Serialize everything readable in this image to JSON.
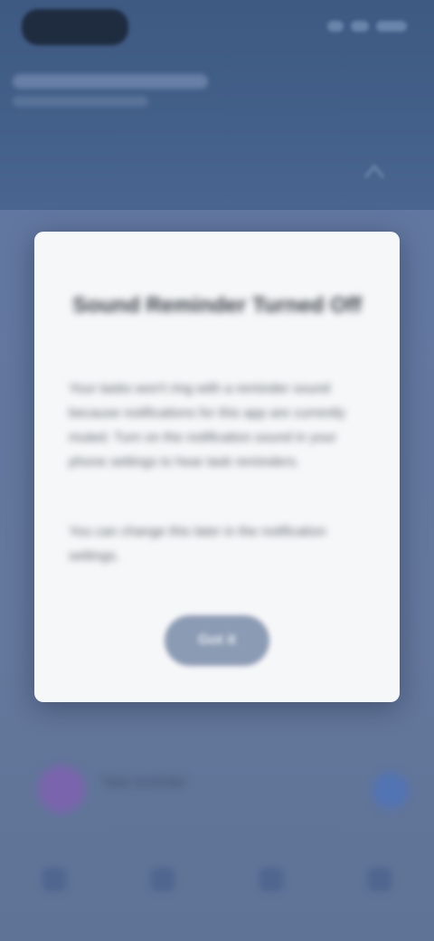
{
  "app": {
    "header_title": "",
    "header_subtitle": ""
  },
  "dialog": {
    "title": "Sound Reminder Turned Off",
    "paragraph_1": "Your tasks won't ring with a reminder sound because notifications for this app are currently muted. Turn on the notification sound in your phone settings to hear task reminders.",
    "paragraph_2": "You can change this later in the notification settings.",
    "button_label": "Got it"
  },
  "task_card": {
    "text": "Task reminder"
  },
  "bottom_nav": {
    "items": [
      "tasks-icon",
      "calendar-icon",
      "focus-icon",
      "settings-icon"
    ]
  },
  "colors": {
    "header": "#3e5a82",
    "overlay": "#6277a0",
    "dialog_background": "#f6f7f9",
    "button": "#8b9bb3",
    "avatar": "#7a64ad",
    "action_button": "#5274b3"
  }
}
